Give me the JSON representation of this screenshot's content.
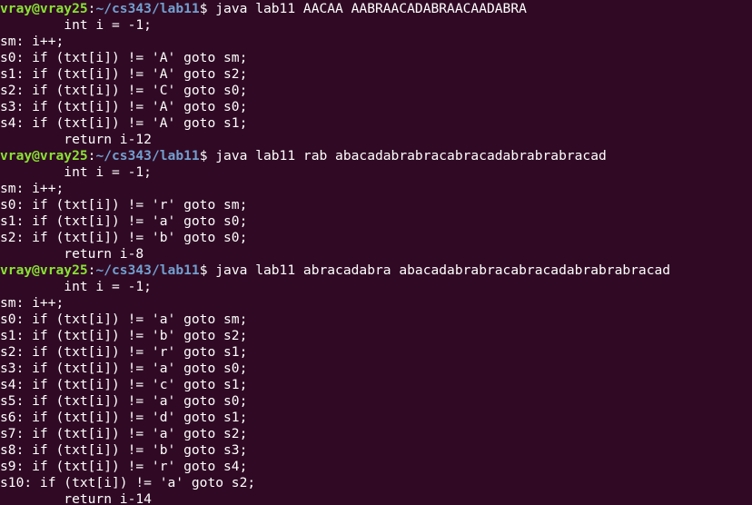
{
  "terminal": {
    "background": "#300a24",
    "user_color": "#8ae234",
    "path_color": "#729fcf",
    "text_color": "#ffffff",
    "lines": [
      {
        "type": "prompt",
        "user": "vray@vray25",
        "sep": ":",
        "path": "~/cs343/lab11",
        "cmd": "$ java lab11 AACAA AABRAACADABRAACAADABRA"
      },
      {
        "type": "text",
        "text": "        int i = -1;"
      },
      {
        "type": "text",
        "text": "sm: i++;"
      },
      {
        "type": "text",
        "text": "s0: if (txt[i]) != 'A' goto sm;"
      },
      {
        "type": "text",
        "text": "s1: if (txt[i]) != 'A' goto s2;"
      },
      {
        "type": "text",
        "text": "s2: if (txt[i]) != 'C' goto s0;"
      },
      {
        "type": "text",
        "text": "s3: if (txt[i]) != 'A' goto s0;"
      },
      {
        "type": "text",
        "text": "s4: if (txt[i]) != 'A' goto s1;"
      },
      {
        "type": "text",
        "text": "        return i-12"
      },
      {
        "type": "prompt",
        "user": "vray@vray25",
        "sep": ":",
        "path": "~/cs343/lab11",
        "cmd": "$ java lab11 rab abacadabrabracabracadabrabrabracad"
      },
      {
        "type": "text",
        "text": "        int i = -1;"
      },
      {
        "type": "text",
        "text": "sm: i++;"
      },
      {
        "type": "text",
        "text": "s0: if (txt[i]) != 'r' goto sm;"
      },
      {
        "type": "text",
        "text": "s1: if (txt[i]) != 'a' goto s0;"
      },
      {
        "type": "text",
        "text": "s2: if (txt[i]) != 'b' goto s0;"
      },
      {
        "type": "text",
        "text": "        return i-8"
      },
      {
        "type": "prompt",
        "user": "vray@vray25",
        "sep": ":",
        "path": "~/cs343/lab11",
        "cmd": "$ java lab11 abracadabra abacadabrabracabracadabrabrabracad"
      },
      {
        "type": "text",
        "text": "        int i = -1;"
      },
      {
        "type": "text",
        "text": "sm: i++;"
      },
      {
        "type": "text",
        "text": "s0: if (txt[i]) != 'a' goto sm;"
      },
      {
        "type": "text",
        "text": "s1: if (txt[i]) != 'b' goto s2;"
      },
      {
        "type": "text",
        "text": "s2: if (txt[i]) != 'r' goto s1;"
      },
      {
        "type": "text",
        "text": "s3: if (txt[i]) != 'a' goto s0;"
      },
      {
        "type": "text",
        "text": "s4: if (txt[i]) != 'c' goto s1;"
      },
      {
        "type": "text",
        "text": "s5: if (txt[i]) != 'a' goto s0;"
      },
      {
        "type": "text",
        "text": "s6: if (txt[i]) != 'd' goto s1;"
      },
      {
        "type": "text",
        "text": "s7: if (txt[i]) != 'a' goto s2;"
      },
      {
        "type": "text",
        "text": "s8: if (txt[i]) != 'b' goto s3;"
      },
      {
        "type": "text",
        "text": "s9: if (txt[i]) != 'r' goto s4;"
      },
      {
        "type": "text",
        "text": "s10: if (txt[i]) != 'a' goto s2;"
      },
      {
        "type": "text",
        "text": "        return i-14"
      }
    ]
  }
}
